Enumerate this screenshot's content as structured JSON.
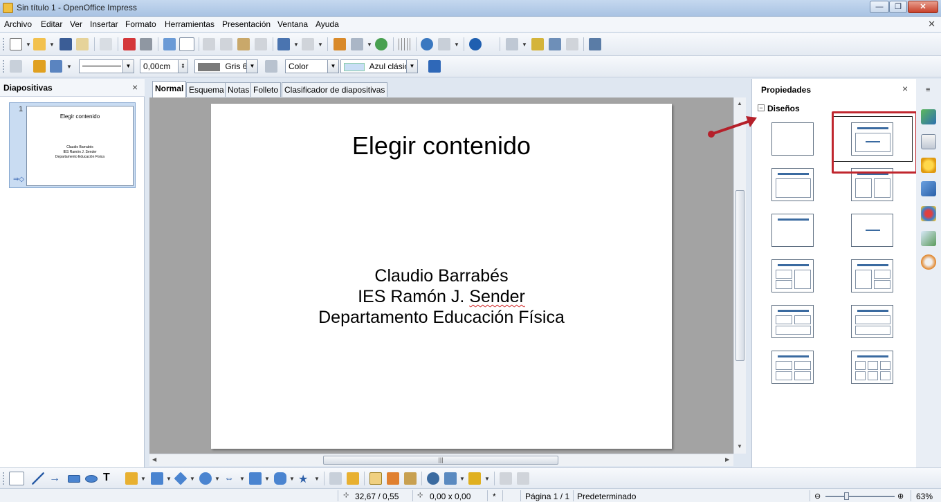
{
  "window": {
    "title": "Sin título 1 - OpenOffice Impress"
  },
  "menu": [
    {
      "label": "Archivo"
    },
    {
      "label": "Editar"
    },
    {
      "label": "Ver"
    },
    {
      "label": "Insertar"
    },
    {
      "label": "Formato"
    },
    {
      "label": "Herramientas"
    },
    {
      "label": "Presentación"
    },
    {
      "label": "Ventana"
    },
    {
      "label": "Ayuda"
    }
  ],
  "line_toolbar": {
    "line_width": "0,00cm",
    "line_color": "Gris 6",
    "area_style": "Color",
    "area_color": "Azul clásico"
  },
  "slides_pane": {
    "title": "Diapositivas",
    "close": "×",
    "slide_number": "1",
    "thumb_title": "Elegir contenido",
    "thumb_lines": [
      "Claudio Barrabés",
      "IES Ramón J. Sender",
      "Departamento Educación Física"
    ]
  },
  "view_tabs": [
    "Normal",
    "Esquema",
    "Notas",
    "Folleto",
    "Clasificador de diapositivas"
  ],
  "slide": {
    "title": "Elegir contenido",
    "lines": [
      "Claudio Barrabés",
      "IES Ramón J. Sender",
      "Departamento Educación Física"
    ]
  },
  "properties_pane": {
    "title": "Propiedades",
    "close": "×",
    "section": "Diseños",
    "section_toggle": "−"
  },
  "status": {
    "position": "32,67 / 0,55",
    "size": "0,00 x 0,00",
    "modified": "*",
    "page": "Página 1 / 1",
    "master": "Predeterminado",
    "zoom": "63%"
  },
  "colors": {
    "highlight": "#c0262e",
    "accent": "#3a6aa0"
  }
}
